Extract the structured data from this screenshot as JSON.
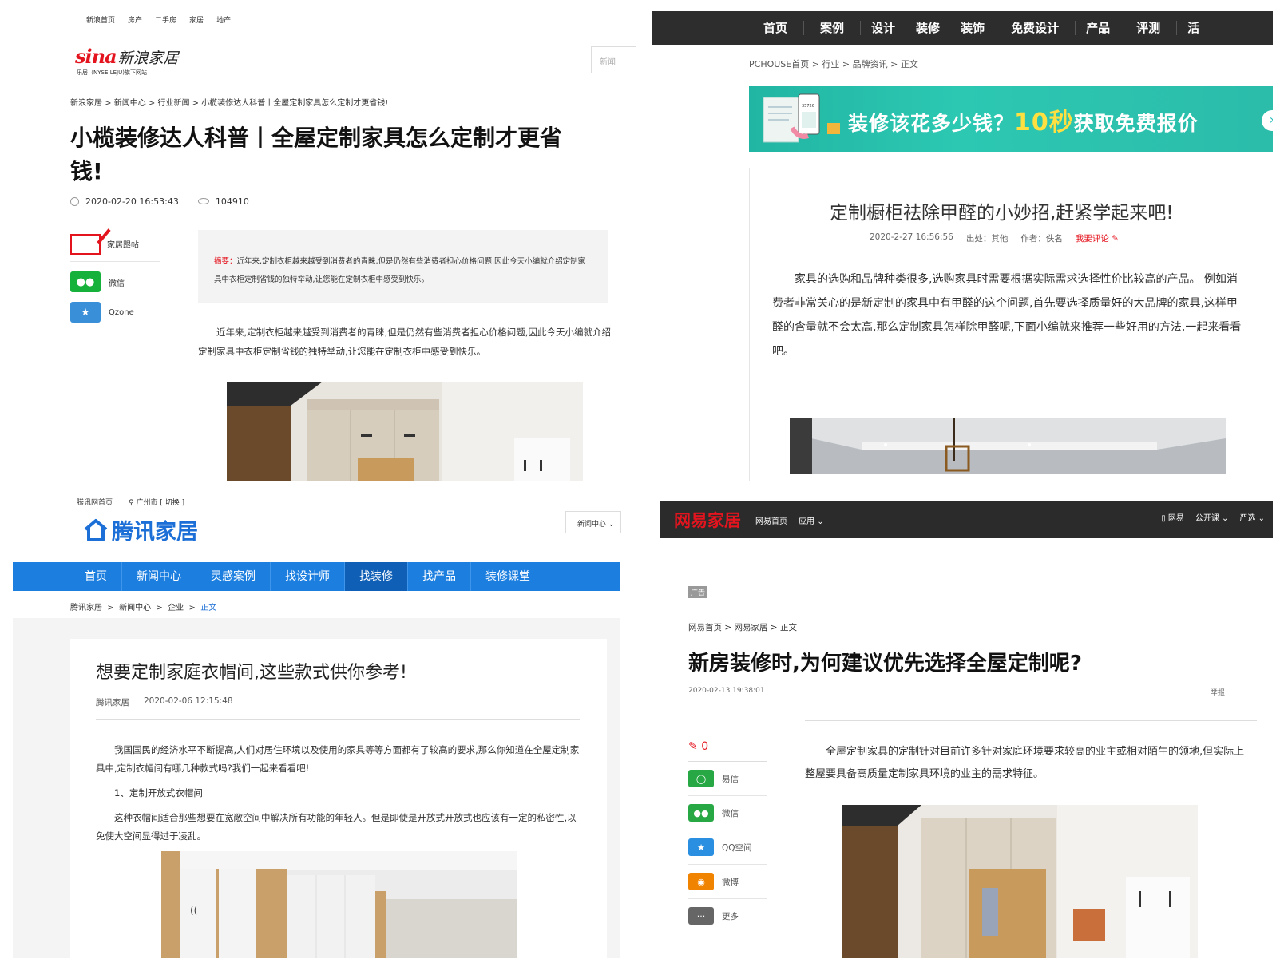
{
  "sina": {
    "topnav": [
      "新浪首页",
      "房产",
      "二手房",
      "家居",
      "地产"
    ],
    "logo_brand": "sina",
    "logo_text": "新浪家居",
    "logo_sub": "乐居（NYSE:LEJU)旗下网站",
    "search_placeholder": "新闻",
    "breadcrumb": "新浪家居 >  新闻中心 > 行业新闻  > 小榄装修达人科普丨全屋定制家具怎么定制才更省钱!",
    "title": "小榄装修达人科普丨全屋定制家具怎么定制才更省钱!",
    "date": "2020-02-20 16:53:43",
    "views": "104910",
    "follow_label": "家居跟帖",
    "share": [
      {
        "label": "微信",
        "color": "#16b13a",
        "icon": "wechat-icon"
      },
      {
        "label": "Qzone",
        "color": "#3a8fd9",
        "icon": "star-icon"
      }
    ],
    "summary_label": "摘要：",
    "summary_text": "近年来,定制衣柜越来越受到消费者的青睐,但是仍然有些消费者担心价格问题,因此今天小编就介绍定制家具中衣柜定制省钱的独特举动,让您能在定制衣柜中感受到快乐。",
    "body": "近年来,定制衣柜越来越受到消费者的青睐,但是仍然有些消费者担心价格问题,因此今天小编就介绍定制家具中衣柜定制省钱的独特举动,让您能在定制衣柜中感受到快乐。"
  },
  "pchouse": {
    "nav": [
      "首页",
      "案例",
      "设计",
      "装修",
      "装饰",
      "免费设计",
      "产品",
      "评测",
      "活"
    ],
    "breadcrumb": "PCHOUSE首页 > 行业 > 品牌资讯 > 正文",
    "banner_text_a": "装修该花多少钱？",
    "banner_text_b": "10秒",
    "banner_text_c": "获取免费报价",
    "banner_phone_num": "35726",
    "title": "定制橱柜祛除甲醛的小妙招,赶紧学起来吧!",
    "date": "2020-2-27 16:56:56",
    "source": "出处：其他",
    "author": "作者：佚名",
    "comment": "我要评论",
    "body": "家具的选购和品牌种类很多,选购家具时需要根据实际需求选择性价比较高的产品。 例如消费者非常关心的是新定制的家具中有甲醛的这个问题,首先要选择质量好的大品牌的家具,这样甲醛的含量就不会太高,那么定制家具怎样除甲醛呢,下面小编就来推荐一些好用的方法,一起来看看吧。"
  },
  "qq": {
    "top_links": [
      "腾讯网首页",
      "广州市 [ 切换 ]"
    ],
    "logo_text": "腾讯家居",
    "select_label": "新闻中心",
    "nav": [
      "首页",
      "新闻中心",
      "灵感案例",
      "找设计师",
      "找装修",
      "找产品",
      "装修课堂"
    ],
    "nav_active": 4,
    "breadcrumb": [
      "腾讯家居",
      "新闻中心",
      "企业",
      "正文"
    ],
    "title": "想要定制家庭衣帽间,这些款式供你参考!",
    "source": "腾讯家居",
    "date": "2020-02-06 12:15:48",
    "p1": "我国国民的经济水平不断提高,人们对居住环境以及使用的家具等等方面都有了较高的要求,那么你知道在全屋定制家具中,定制衣帽间有哪几种款式吗?我们一起来看看吧!",
    "p2": "1、定制开放式衣帽间",
    "p3": "这种衣帽间适合那些想要在宽敞空间中解决所有功能的年轻人。但是即使是开放式开放式也应该有一定的私密性,以免使大空间显得过于凌乱。"
  },
  "netease": {
    "logo_text": "网易家居",
    "nav_links": [
      "网易首页",
      "应用"
    ],
    "right_links": [
      "网易",
      "公开课",
      "严选"
    ],
    "ad_label": "广告",
    "breadcrumb": "网易首页 > 网易家居 > 正文",
    "title": "新房装修时,为何建议优先选择全屋定制呢?",
    "date": "2020-02-13 19:38:01",
    "report": "举报",
    "comment_count": "0",
    "share": [
      {
        "label": "易信",
        "color": "#27a844",
        "icon": "yixin-icon"
      },
      {
        "label": "微信",
        "color": "#27a844",
        "icon": "wechat-icon"
      },
      {
        "label": "QQ空间",
        "color": "#2a8fe0",
        "icon": "star-icon"
      },
      {
        "label": "微博",
        "color": "#f08300",
        "icon": "weibo-icon"
      },
      {
        "label": "更多",
        "color": "#666666",
        "icon": "more-icon"
      }
    ],
    "body": "全屋定制家具的定制针对目前许多针对家庭环境要求较高的业主或相对陌生的领地,但实际上整屋要具备高质量定制家具环境的业主的需求特征。"
  }
}
